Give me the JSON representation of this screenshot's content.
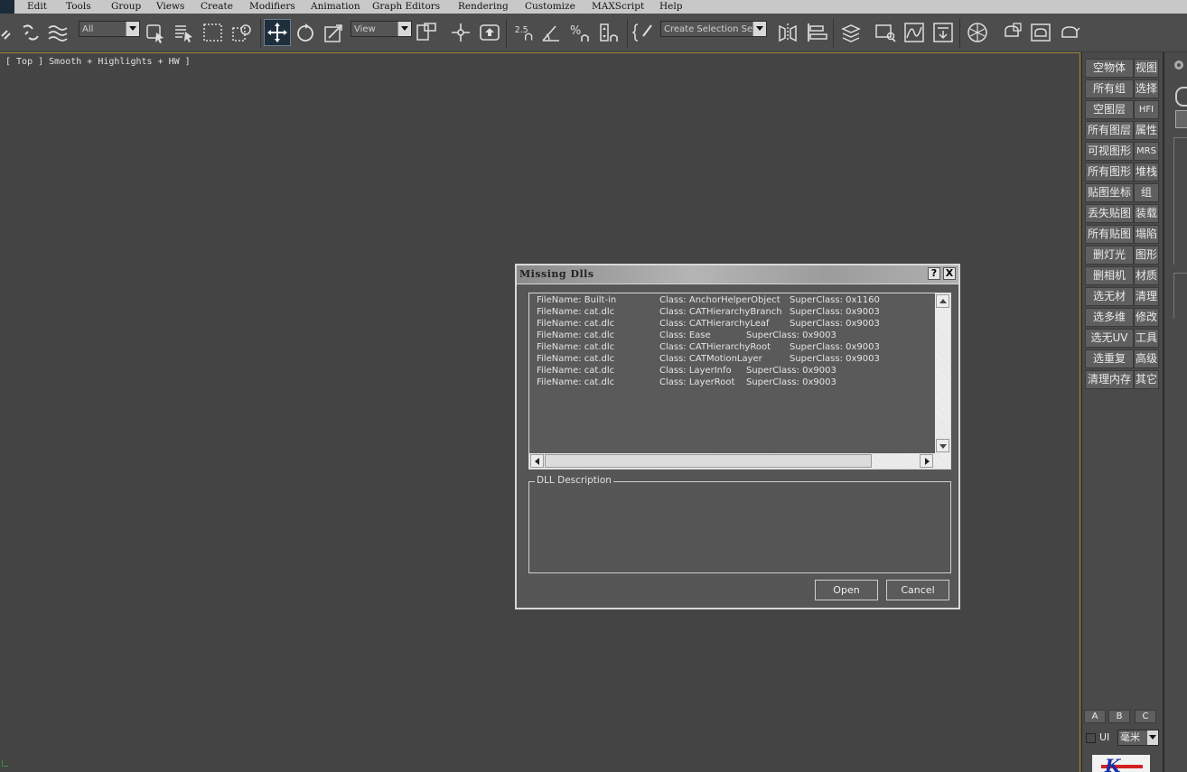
{
  "menubar": {
    "items": [
      "Edit",
      "Tools",
      "Group",
      "Views",
      "Create",
      "Modifiers",
      "Animation",
      "Graph Editors",
      "Rendering",
      "Customize",
      "MAXScript",
      "Help"
    ]
  },
  "toolbar": {
    "selection_filter": "All",
    "reference_coord": "View",
    "named_selection_placeholder": "Create Selection Set",
    "snap_angle_label": "2.5"
  },
  "viewport": {
    "label": "[ Top ] Smooth + Highlights + HW ]"
  },
  "right_panel": {
    "left_col": [
      "空物体",
      "所有组",
      "空图层",
      "所有图层",
      "可视图形",
      "所有图形",
      "贴图坐标",
      "丢失贴图",
      "所有贴图",
      "删灯光",
      "删相机",
      "选无材",
      "选多维",
      "选无UV",
      "选重复",
      "清理内存"
    ],
    "right_col": [
      "视图",
      "选择",
      "HFI",
      "属性",
      "MRS",
      "堆栈",
      "组",
      "装载",
      "塌陷",
      "图形",
      "材质",
      "清理",
      "修改",
      "工具",
      "高级",
      "其它"
    ],
    "abc": [
      "A",
      "B",
      "C"
    ],
    "ui_label": "UI",
    "unit_value": "毫米"
  },
  "dialog": {
    "title": "Missing Dlls",
    "help_label": "?",
    "close_label": "X",
    "rows": [
      {
        "file": "FileName:  Built-in",
        "cls": "Class: AnchorHelperObject",
        "sup": "SuperClass: 0x1160"
      },
      {
        "file": "FileName:  cat.dlc",
        "cls": "Class: CATHierarchyBranch",
        "sup": "SuperClass: 0x9003"
      },
      {
        "file": "FileName:  cat.dlc",
        "cls": "Class: CATHierarchyLeaf",
        "sup": "SuperClass: 0x9003"
      },
      {
        "file": "FileName:  cat.dlc",
        "cls": "Class: Ease",
        "sup": "SuperClass: 0x9003"
      },
      {
        "file": "FileName:  cat.dlc",
        "cls": "Class: CATHierarchyRoot",
        "sup": "SuperClass: 0x9003"
      },
      {
        "file": "FileName:  cat.dlc",
        "cls": "Class: CATMotionLayer",
        "sup": "SuperClass: 0x9003"
      },
      {
        "file": "FileName:  cat.dlc",
        "cls": "Class: LayerInfo",
        "sup": "SuperClass: 0x9003"
      },
      {
        "file": "FileName:  cat.dlc",
        "cls": "Class: LayerRoot",
        "sup": "SuperClass: 0x9003"
      }
    ],
    "description_label": "DLL Description",
    "open_label": "Open",
    "cancel_label": "Cancel"
  }
}
